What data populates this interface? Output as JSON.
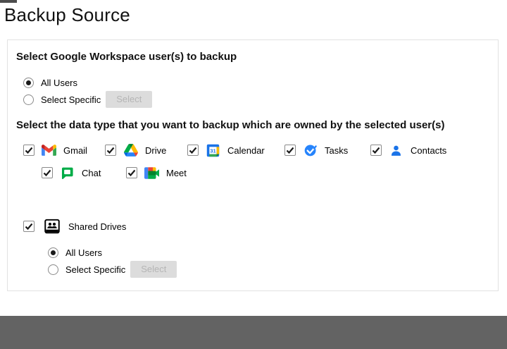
{
  "page": {
    "title": "Backup Source"
  },
  "user_selection": {
    "heading": "Select Google Workspace user(s) to backup",
    "all_users_label": "All Users",
    "select_specific_label": "Select Specific",
    "select_button_label": "Select",
    "selected_option": "All Users"
  },
  "data_types": {
    "heading": "Select the data type that you want to backup which are owned by the selected user(s)",
    "items": [
      {
        "label": "Gmail",
        "icon": "gmail-icon",
        "checked": true
      },
      {
        "label": "Drive",
        "icon": "drive-icon",
        "checked": true
      },
      {
        "label": "Calendar",
        "icon": "calendar-icon",
        "checked": true
      },
      {
        "label": "Tasks",
        "icon": "tasks-icon",
        "checked": true
      },
      {
        "label": "Contacts",
        "icon": "contacts-icon",
        "checked": true
      },
      {
        "label": "Chat",
        "icon": "chat-icon",
        "checked": true
      },
      {
        "label": "Meet",
        "icon": "meet-icon",
        "checked": true
      }
    ],
    "calendar_day": "31"
  },
  "shared_drives": {
    "label": "Shared Drives",
    "icon": "shared-drives-icon",
    "checked": true,
    "all_users_label": "All Users",
    "select_specific_label": "Select Specific",
    "select_button_label": "Select",
    "selected_option": "All Users"
  },
  "colors": {
    "footer_gray": "#636363",
    "panel_border": "#e2e2e2",
    "disabled_button_bg": "#dcdcdc",
    "disabled_button_text": "#b5b5b5",
    "google_blue": "#4285f4",
    "google_red": "#ea4335",
    "google_yellow": "#fbbc04",
    "google_green": "#34a853"
  }
}
